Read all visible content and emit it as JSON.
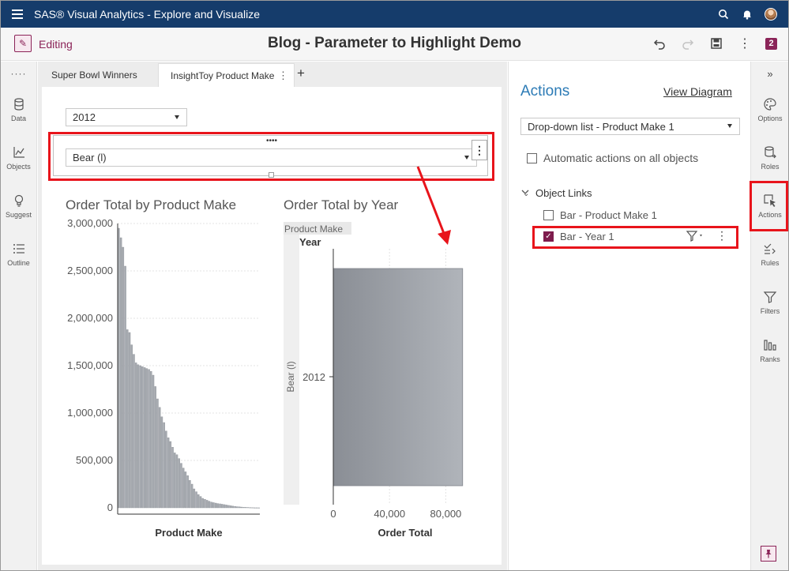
{
  "app": {
    "title": "SAS® Visual Analytics - Explore and Visualize"
  },
  "editbar": {
    "mode_label": "Editing",
    "report_title": "Blog - Parameter to Highlight Demo",
    "badge": "2"
  },
  "left_rail": {
    "items": [
      {
        "label": "Data",
        "icon": "database-icon"
      },
      {
        "label": "Objects",
        "icon": "chart-line-icon"
      },
      {
        "label": "Suggest",
        "icon": "lightbulb-icon"
      },
      {
        "label": "Outline",
        "icon": "list-icon"
      }
    ]
  },
  "tabs": [
    {
      "label": "Super Bowl Winners",
      "active": false
    },
    {
      "label": "InsightToy Product Make",
      "active": true
    }
  ],
  "controls": {
    "year_value": "2012",
    "make_value": "Bear (l)"
  },
  "charts": {
    "left": {
      "title": "Order Total by Product Make",
      "xlabel": "Product Make"
    },
    "right": {
      "title": "Order Total by Year",
      "group_label": "Product Make",
      "year_axis_label": "Year",
      "group_value": "Bear (l)",
      "category": "2012",
      "xlabel": "Order Total"
    }
  },
  "chart_data": [
    {
      "type": "bar",
      "title": "Order Total by Product Make",
      "xlabel": "Product Make",
      "ylabel": "",
      "ylim": [
        0,
        3000000
      ],
      "yticks": [
        "0",
        "500,000",
        "1,000,000",
        "1,500,000",
        "2,000,000",
        "2,500,000",
        "3,000,000"
      ],
      "values": [
        2950000,
        2850000,
        2750000,
        2550000,
        1880000,
        1850000,
        1720000,
        1620000,
        1530000,
        1510000,
        1500000,
        1490000,
        1480000,
        1470000,
        1460000,
        1440000,
        1400000,
        1280000,
        1150000,
        1060000,
        960000,
        900000,
        810000,
        740000,
        700000,
        640000,
        580000,
        560000,
        520000,
        470000,
        420000,
        380000,
        340000,
        290000,
        250000,
        200000,
        170000,
        140000,
        120000,
        100000,
        90000,
        80000,
        70000,
        60000,
        55000,
        50000,
        45000,
        42000,
        38000,
        34000,
        30000,
        26000,
        22000,
        18000,
        15000,
        12000,
        10000,
        8000,
        6000,
        5000,
        4000,
        3000,
        2000,
        1000,
        800,
        500
      ]
    },
    {
      "type": "bar",
      "orientation": "horizontal",
      "title": "Order Total by Year",
      "xlabel": "Order Total",
      "ylabel": "Year",
      "categories": [
        "2012"
      ],
      "values": [
        92000
      ],
      "xlim": [
        0,
        100000
      ],
      "xticks": [
        "0",
        "40,000",
        "80,000"
      ]
    }
  ],
  "actions_pane": {
    "title": "Actions",
    "view_diagram": "View Diagram",
    "source_select": "Drop-down list - Product Make 1",
    "automatic": {
      "label": "Automatic actions on all objects",
      "checked": false
    },
    "object_links_label": "Object Links",
    "links": [
      {
        "label": "Bar - Product Make 1",
        "checked": false
      },
      {
        "label": "Bar - Year 1",
        "checked": true
      }
    ]
  },
  "right_rail": {
    "items": [
      {
        "label": "Options",
        "icon": "palette-icon"
      },
      {
        "label": "Roles",
        "icon": "roles-icon"
      },
      {
        "label": "Actions",
        "icon": "actions-icon"
      },
      {
        "label": "Rules",
        "icon": "rules-icon"
      },
      {
        "label": "Filters",
        "icon": "filter-icon"
      },
      {
        "label": "Ranks",
        "icon": "ranks-icon"
      }
    ]
  },
  "colors": {
    "header": "#153c6b",
    "accent": "#8b2458",
    "link_blue": "#2c7bb6",
    "highlight": "#e8141b",
    "bar": "#a7abb1"
  }
}
